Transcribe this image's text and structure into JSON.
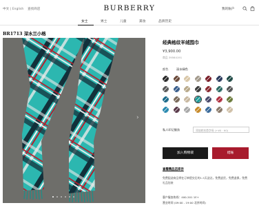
{
  "header": {
    "language": "中文 | English",
    "store_finder": "查找商店",
    "brand": "BURBERRY",
    "account": "我的账户",
    "search_icon": "search-icon",
    "bag_icon": "shopping-bag-icon"
  },
  "nav": {
    "items": [
      {
        "label": "女士",
        "active": true
      },
      {
        "label": "男士",
        "active": false
      },
      {
        "label": "儿童",
        "active": false
      },
      {
        "label": "美妆",
        "active": false
      },
      {
        "label": "品牌历史",
        "active": false
      }
    ]
  },
  "product": {
    "code": "BR1713 深水兰小格",
    "title": "经典格纹羊绒围巾",
    "price": "¥3,900.00",
    "item_no": "商品 39564191",
    "color_label": "颜色",
    "color_name": "深水绿色",
    "swatches": [
      "#2a2a2a",
      "#6b4a3a",
      "#d9c7a8",
      "#a39a8c",
      "#7a1f2a",
      "#2b3a5c",
      "#1f4a46",
      "#5a5a5a",
      "#3a5e8c",
      "#b8a98a",
      "#3c3c3c",
      "#8a2a30",
      "#2d6b64",
      "#555555",
      "#1b6a8a",
      "#7a6a5a",
      "#c8b8a0",
      "#1e9c9a",
      "#4a4a6a",
      "#b03040",
      "#6a7a3a",
      "#2a8ab0",
      "#5a3a4a",
      "#a8a8a8",
      "#c78a2a",
      "#3a6a9a",
      "#8a7a6a",
      "#d0c0a8"
    ],
    "selected_swatch": 17
  },
  "monogram": {
    "label": "私人印记服务",
    "placeholder": "添加姓名首字母 (+¥0 · ¥0)"
  },
  "actions": {
    "add_to_bag": "加入购物袋",
    "checkout": "结账"
  },
  "info": {
    "stock_link": "查看精品店库存",
    "shipping_text": "免费配送商品将在订单提交后的1-5天送达，免费退货，免费退换，免费礼品包装",
    "hotline": "客户服务热线：400-201 1E+",
    "hours": "营业时间 (09:00 - 19:00 北京时间)"
  },
  "gallery": {
    "dot_count": 6,
    "active_dot": 0,
    "next_arrow": "›"
  },
  "colors": {
    "accent_red": "#a81b2d",
    "scarf_teal": "#2cb7b0",
    "dark_button": "#1a1a1a"
  }
}
